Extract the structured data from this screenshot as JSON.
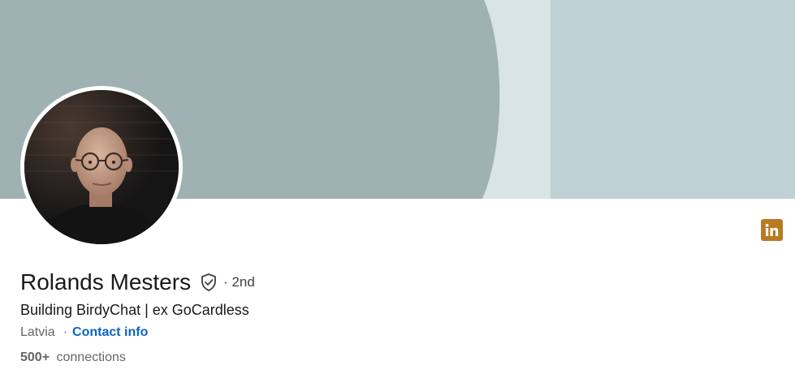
{
  "profile": {
    "name": "Rolands Mesters",
    "degree": "· 2nd",
    "headline": "Building BirdyChat | ex GoCardless",
    "location": "Latvia",
    "separator": "·",
    "contact_info_label": "Contact info",
    "connections_count": "500+",
    "connections_label": "connections"
  },
  "icons": {
    "verified": "shield-check-icon",
    "linkedin": "linkedin-icon"
  },
  "colors": {
    "banner_dark": "#a0b1b4",
    "banner_light": "#d9e4e6",
    "banner_right": "#bfd1d5",
    "link_blue": "#0a66c2",
    "linkedin_badge": "#b87a23"
  }
}
